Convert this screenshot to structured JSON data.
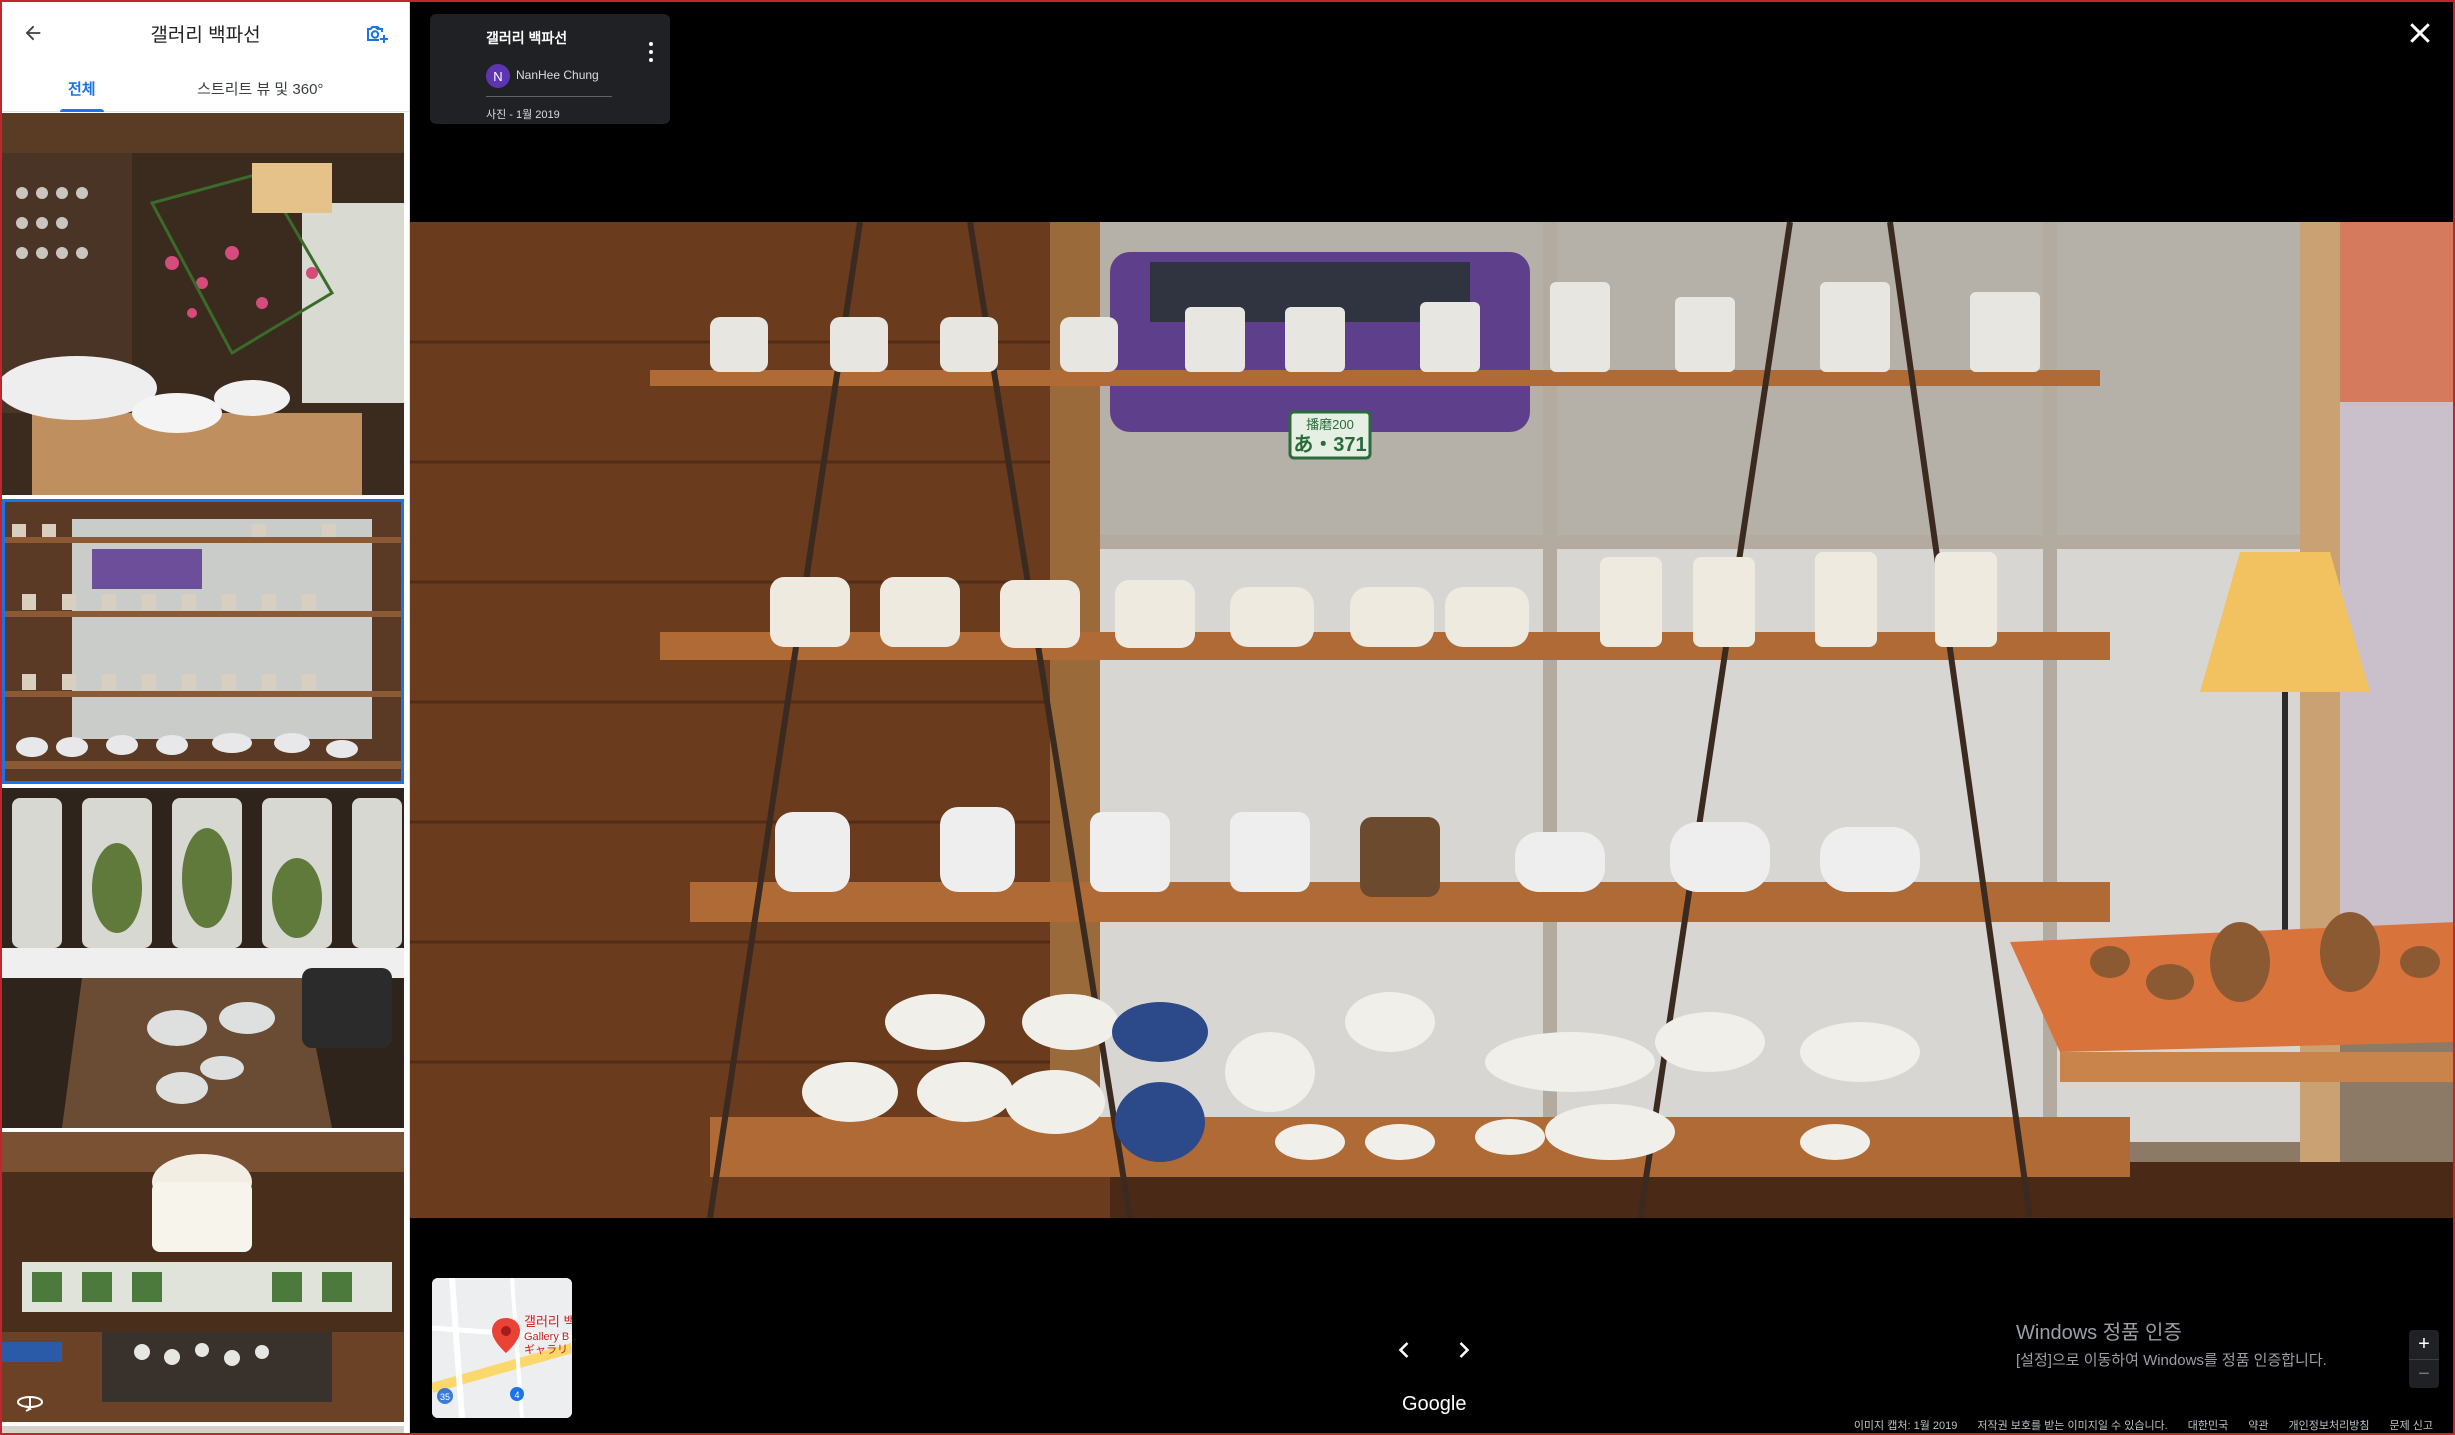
{
  "panel": {
    "title": "갤러리 백파선",
    "tabs": [
      {
        "label": "전체"
      },
      {
        "label": "스트리트 뷰 및 360°"
      }
    ]
  },
  "info_card": {
    "title": "갤러리 백파선",
    "avatar_letter": "N",
    "author": "NanHee Chung",
    "date": "사진 - 1월 2019"
  },
  "map": {
    "label_ko": "갤러리 백",
    "label_en": "Gallery B",
    "label_jp": "ギャラリ",
    "road_number": "35",
    "marker_number": "4"
  },
  "car_plate": {
    "line1": "播磨200",
    "line2": "あ・371"
  },
  "google_logo": "Google",
  "windows_watermark": {
    "title": "Windows 정품 인증",
    "subtitle": "[설정]으로 이동하여 Windows를 정품 인증합니다."
  },
  "zoom": {
    "in": "+",
    "out": "−"
  },
  "footer": [
    "이미지 캡처: 1월 2019",
    "저작권 보호를 받는 이미지일 수 있습니다.",
    "대한민국",
    "약관",
    "개인정보처리방침",
    "문제 신고"
  ],
  "colors": {
    "accent": "#1a73e8",
    "card_bg": "#202124",
    "avatar": "#5e35b1",
    "frame_border": "#c0272d"
  },
  "icons": {
    "back": "arrow-left-icon",
    "add_photo": "camera-plus-icon",
    "more": "more-vert-icon",
    "close": "close-icon",
    "prev": "chevron-left-icon",
    "next": "chevron-right-icon",
    "collapse": "caret-left-icon",
    "panorama": "360-icon"
  }
}
